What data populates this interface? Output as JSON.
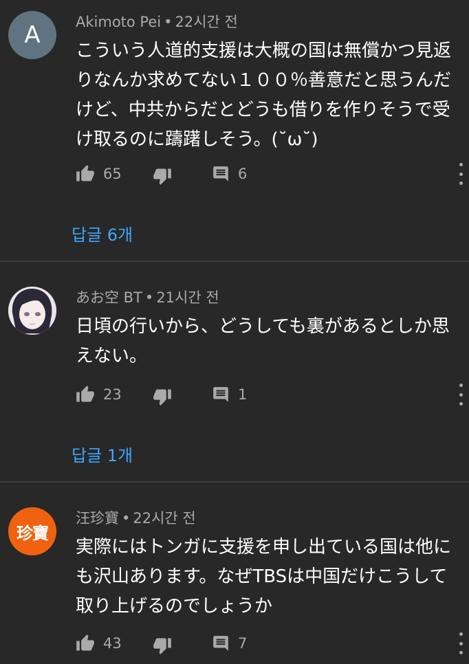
{
  "comments": [
    {
      "author": "Akimoto Pei",
      "time": "22시간 전",
      "avatar_letter": "A",
      "avatar_color": "#5f7480",
      "text": "こういう人道的支援は大概の国は無償かつ見返りなんか求めてない１００％善意だと思うんだけど、中共からだとどうも借りを作りそうで受け取るのに躊躇しそう。(˘ω˘)",
      "likes": "65",
      "reply_count": "6",
      "replies_label": "답글 6개"
    },
    {
      "author": "あお空 BT",
      "time": "21시간 전",
      "avatar_icon": "anime-avatar-icon",
      "text": "日頃の行いから、どうしても裏があるとしか思えない。",
      "likes": "23",
      "reply_count": "1",
      "replies_label": "답글 1개"
    },
    {
      "author": "汪珍寶",
      "time": "22시간 전",
      "avatar_text": "珍寶",
      "avatar_color": "#f0620f",
      "text": "実際にはトンガに支援を申し出ている国は他にも沢山あります。なぜTBSは中国だけこうして取り上げるのでしょうか",
      "likes": "43",
      "reply_count": "7"
    }
  ],
  "meta_separator": "•",
  "icons": {
    "like": "thumbs-up-icon",
    "dislike": "thumbs-down-icon",
    "reply": "comment-icon",
    "more": "more-vertical-icon"
  },
  "colors": {
    "background": "#282828",
    "link": "#3ea6ff",
    "secondary_text": "#aaaaaa"
  }
}
